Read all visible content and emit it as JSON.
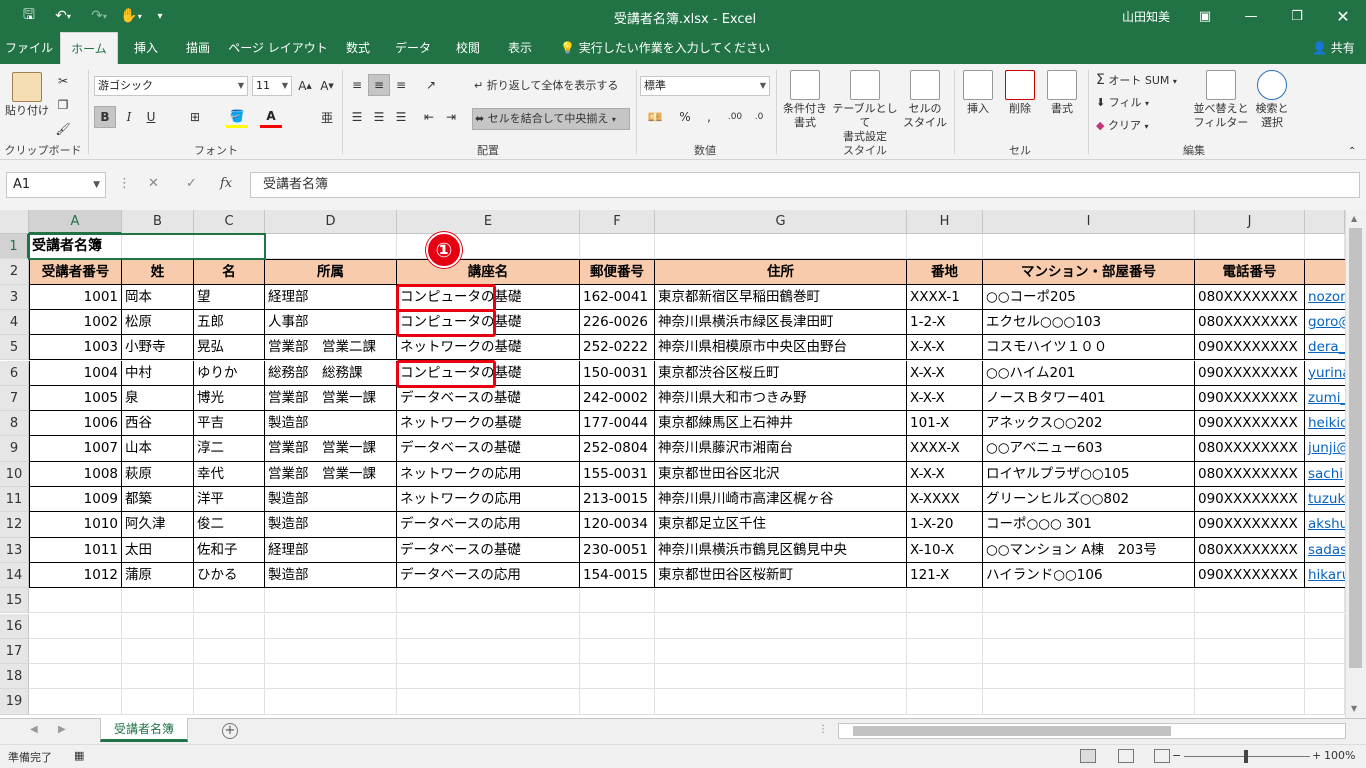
{
  "titlebar": {
    "title": "受講者名簿.xlsx  -  Excel",
    "user": "山田知美"
  },
  "tabs": [
    "ファイル",
    "ホーム",
    "挿入",
    "描画",
    "ページ レイアウト",
    "数式",
    "データ",
    "校閲",
    "表示"
  ],
  "tellme": "実行したい作業を入力してください",
  "share": "共有",
  "ribbon": {
    "clipboard": {
      "paste": "貼り付け",
      "label": "クリップボード"
    },
    "font": {
      "name": "游ゴシック",
      "size": "11",
      "bold": "B",
      "italic": "I",
      "underline": "U",
      "label": "フォント"
    },
    "alignment": {
      "wrap": "折り返して全体を表示する",
      "merge": "セルを結合して中央揃え",
      "label": "配置"
    },
    "number": {
      "format": "標準",
      "label": "数値"
    },
    "styles": {
      "conditional": "条件付き\n書式",
      "table": "テーブルとして\n書式設定",
      "cell": "セルの\nスタイル",
      "label": "スタイル"
    },
    "cells": {
      "insert": "挿入",
      "delete": "削除",
      "format": "書式",
      "label": "セル"
    },
    "editing": {
      "autosum": "オート SUM",
      "fill": "フィル",
      "clear": "クリア",
      "sort": "並べ替えと\nフィルター",
      "find": "検索と\n選択",
      "label": "編集"
    }
  },
  "formula_bar": {
    "name_box": "A1",
    "formula": "受講者名簿"
  },
  "columns": [
    "A",
    "B",
    "C",
    "D",
    "E",
    "F",
    "G",
    "H",
    "I",
    "J"
  ],
  "row_numbers": [
    "1",
    "2",
    "3",
    "4",
    "5",
    "6",
    "7",
    "8",
    "9",
    "10",
    "11",
    "12",
    "13",
    "14",
    "15",
    "16",
    "17",
    "18",
    "19"
  ],
  "sheet": {
    "title": "受講者名簿",
    "headers": [
      "受講者番号",
      "姓",
      "名",
      "所属",
      "講座名",
      "郵便番号",
      "住所",
      "番地",
      "マンション・部屋番号",
      "電話番号"
    ],
    "rows": [
      [
        "1001",
        "岡本",
        "望",
        "経理部",
        "コンピュータの基礎",
        "162-0041",
        "東京都新宿区早稲田鶴巻町",
        "XXXX-1",
        "○○コーポ205",
        "080XXXXXXXX",
        "nozom"
      ],
      [
        "1002",
        "松原",
        "五郎",
        "人事部",
        "コンピュータの基礎",
        "226-0026",
        "神奈川県横浜市緑区長津田町",
        "1-2-X",
        "エクセル○○○103",
        "080XXXXXXXX",
        "goro@"
      ],
      [
        "1003",
        "小野寺",
        "晃弘",
        "営業部　営業二課",
        "ネットワークの基礎",
        "252-0222",
        "神奈川県相模原市中央区由野台",
        "X-X-X",
        "コスモハイツ１００",
        "090XXXXXXXX",
        "dera_"
      ],
      [
        "1004",
        "中村",
        "ゆりか",
        "総務部　総務課",
        "コンピュータの基礎",
        "150-0031",
        "東京都渋谷区桜丘町",
        "X-X-X",
        "○○ハイム201",
        "090XXXXXXXX",
        "yurina"
      ],
      [
        "1005",
        "泉",
        "博光",
        "営業部　営業一課",
        "データベースの基礎",
        "242-0002",
        "神奈川県大和市つきみ野",
        "X-X-X",
        "ノースＢタワー401",
        "090XXXXXXXX",
        "zumi_"
      ],
      [
        "1006",
        "西谷",
        "平吉",
        "製造部",
        "ネットワークの基礎",
        "177-0044",
        "東京都練馬区上石神井",
        "101-X",
        "アネックス○○202",
        "090XXXXXXXX",
        "heikic"
      ],
      [
        "1007",
        "山本",
        "淳二",
        "営業部　営業一課",
        "データベースの基礎",
        "252-0804",
        "神奈川県藤沢市湘南台",
        "XXXX-X",
        "○○アベニュー603",
        "080XXXXXXXX",
        "junji@"
      ],
      [
        "1008",
        "萩原",
        "幸代",
        "営業部　営業一課",
        "ネットワークの応用",
        "155-0031",
        "東京都世田谷区北沢",
        "X-X-X",
        "ロイヤルプラザ○○105",
        "080XXXXXXXX",
        "sachi"
      ],
      [
        "1009",
        "都築",
        "洋平",
        "製造部",
        "ネットワークの応用",
        "213-0015",
        "神奈川県川崎市高津区梶ヶ谷",
        "X-XXXX",
        "グリーンヒルズ○○802",
        "090XXXXXXXX",
        "tuzuk"
      ],
      [
        "1010",
        "阿久津",
        "俊二",
        "製造部",
        "データベースの応用",
        "120-0034",
        "東京都足立区千住",
        "1-X-20",
        "コーポ○○○ 301",
        "090XXXXXXXX",
        "akshu"
      ],
      [
        "1011",
        "太田",
        "佐和子",
        "経理部",
        "データベースの基礎",
        "230-0051",
        "神奈川県横浜市鶴見区鶴見中央",
        "X-10-X",
        "○○マンション A棟　203号",
        "080XXXXXXXX",
        "sadas"
      ],
      [
        "1012",
        "蒲原",
        "ひかる",
        "製造部",
        "データベースの応用",
        "154-0015",
        "東京都世田谷区桜新町",
        "121-X",
        "ハイランド○○106",
        "090XXXXXXXX",
        "hikaru"
      ]
    ]
  },
  "callout": "①",
  "sheet_tab": "受講者名簿",
  "status": {
    "ready": "準備完了",
    "zoom": "100%"
  },
  "colors": {
    "excel_green": "#217346",
    "header_fill": "#f8cbad",
    "highlight": "#e60012",
    "link": "#0563c1"
  }
}
